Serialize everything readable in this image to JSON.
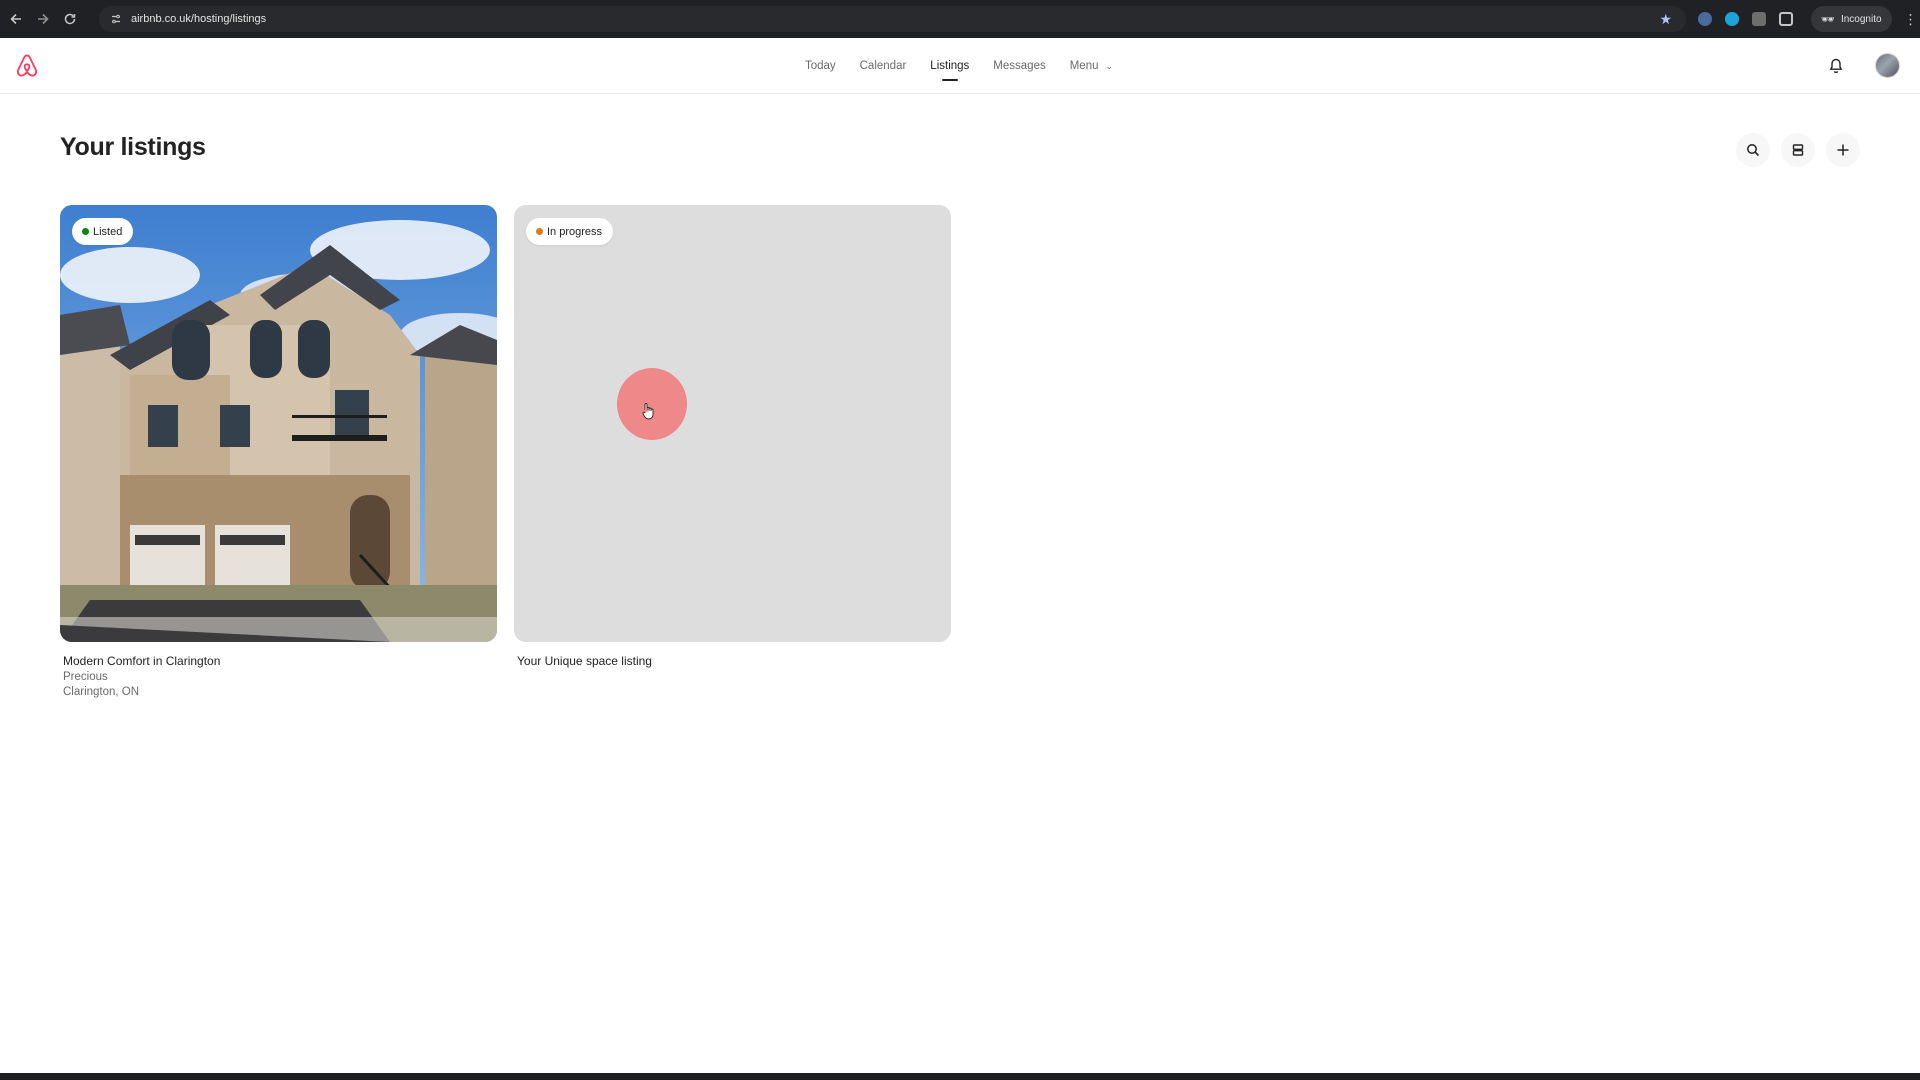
{
  "browser": {
    "url": "airbnb.co.uk/hosting/listings",
    "incognito_label": "Incognito"
  },
  "header": {
    "nav": [
      {
        "label": "Today"
      },
      {
        "label": "Calendar"
      },
      {
        "label": "Listings"
      },
      {
        "label": "Messages"
      },
      {
        "label": "Menu"
      }
    ],
    "active_nav": "Listings"
  },
  "page": {
    "title": "Your listings"
  },
  "listings": [
    {
      "status": "Listed",
      "status_color": "#008a05",
      "title": "Modern Comfort in Clarington",
      "host": "Precious",
      "location": "Clarington, ON"
    },
    {
      "status": "In progress",
      "status_color": "#e07912",
      "title": "Your Unique space listing"
    }
  ],
  "colors": {
    "brand": "#FF385C",
    "chrome": "#202124",
    "placeholder": "#dddddd"
  },
  "icons": [
    "back-icon",
    "forward-icon",
    "reload-icon",
    "site-info-icon",
    "bookmark-star-icon",
    "incognito-icon",
    "airbnb-logo-icon",
    "bell-icon",
    "search-icon",
    "list-view-icon",
    "plus-icon"
  ]
}
